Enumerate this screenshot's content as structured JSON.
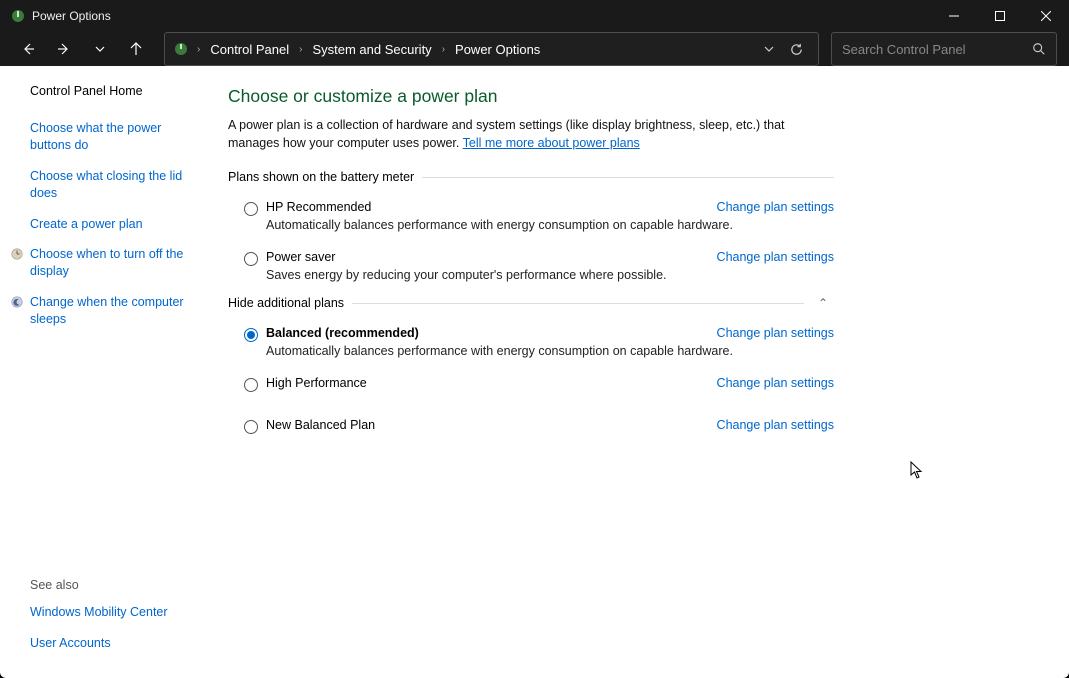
{
  "window": {
    "title": "Power Options"
  },
  "breadcrumb": {
    "items": [
      "Control Panel",
      "System and Security",
      "Power Options"
    ]
  },
  "search": {
    "placeholder": "Search Control Panel"
  },
  "sidebar": {
    "home": "Control Panel Home",
    "links": [
      "Choose what the power buttons do",
      "Choose what closing the lid does",
      "Create a power plan",
      "Choose when to turn off the display",
      "Change when the computer sleeps"
    ],
    "seealso_head": "See also",
    "seealso": [
      "Windows Mobility Center",
      "User Accounts"
    ]
  },
  "main": {
    "heading": "Choose or customize a power plan",
    "desc_prefix": "A power plan is a collection of hardware and system settings (like display brightness, sleep, etc.) that manages how your computer uses power. ",
    "desc_link": "Tell me more about power plans",
    "section1": "Plans shown on the battery meter",
    "section2": "Hide additional plans",
    "change_label": "Change plan settings",
    "plans_battery": [
      {
        "name": "HP Recommended",
        "desc": "Automatically balances performance with energy consumption on capable hardware.",
        "selected": false
      },
      {
        "name": "Power saver",
        "desc": "Saves energy by reducing your computer's performance where possible.",
        "selected": false
      }
    ],
    "plans_additional": [
      {
        "name": "Balanced (recommended)",
        "desc": "Automatically balances performance with energy consumption on capable hardware.",
        "selected": true
      },
      {
        "name": "High Performance",
        "desc": "",
        "selected": false
      },
      {
        "name": "New Balanced Plan",
        "desc": "",
        "selected": false
      }
    ]
  }
}
